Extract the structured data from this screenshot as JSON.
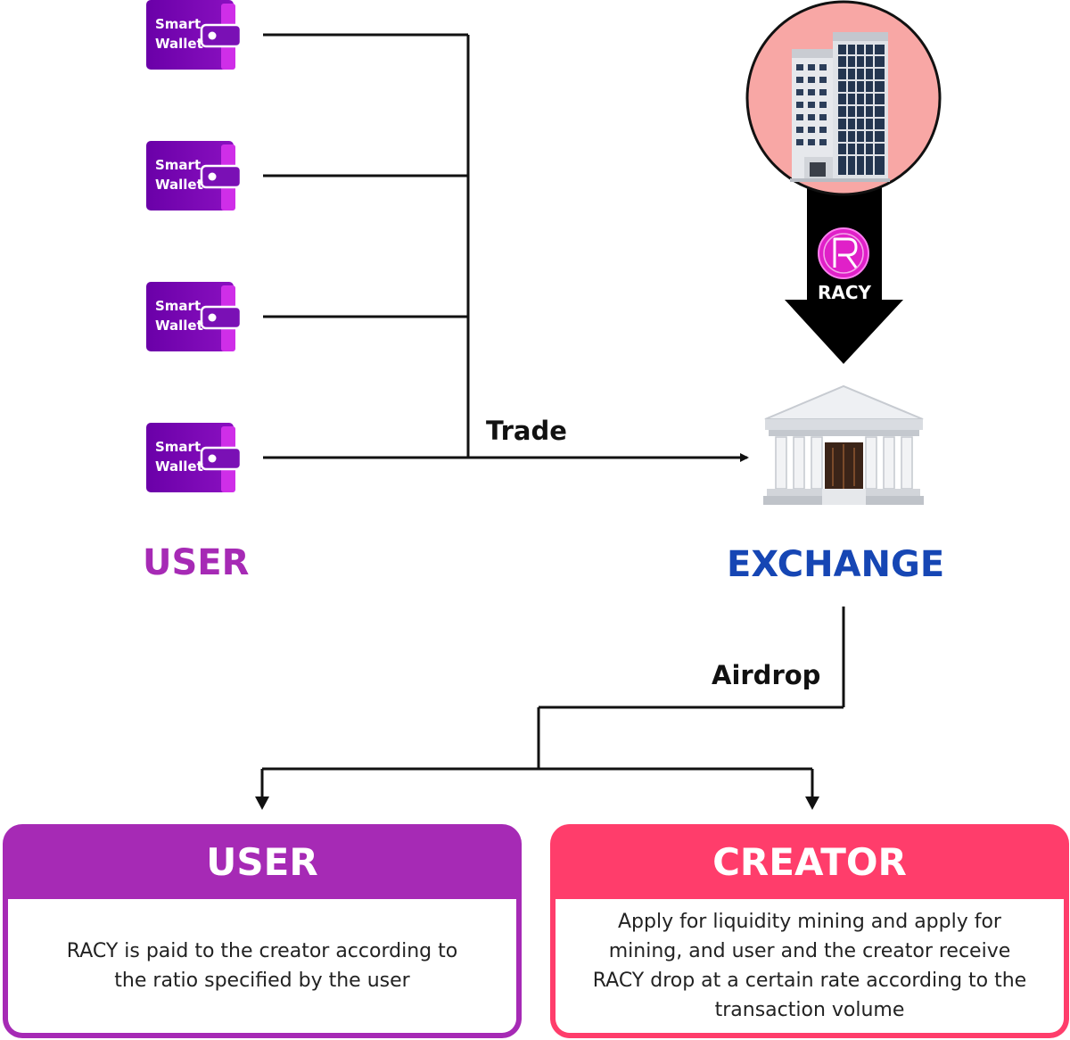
{
  "wallets": [
    {
      "line1": "Smart",
      "line2": "Wallet"
    },
    {
      "line1": "Smart",
      "line2": "Wallet"
    },
    {
      "line1": "Smart",
      "line2": "Wallet"
    },
    {
      "line1": "Smart",
      "line2": "Wallet"
    }
  ],
  "labels": {
    "trade": "Trade",
    "airdrop": "Airdrop",
    "token": "RACY",
    "user_side": "USER",
    "exchange_side": "EXCHANGE"
  },
  "cards": {
    "user": {
      "title": "USER",
      "text": "RACY is paid to the creator according to the ratio specified by the user"
    },
    "creator": {
      "title": "CREATOR",
      "text": "Apply for liquidity mining and apply for mining, and user and the creator receive RACY drop at a certain rate according to the transaction volume"
    }
  },
  "colors": {
    "user_purple": "#a62ab5",
    "exchange_blue": "#1646b4",
    "creator_pink": "#ff3d6b",
    "wallet_dark": "#6a00a8",
    "wallet_light": "#cf2ee8",
    "token_magenta": "#e020c8",
    "building_bg": "#f8a7a5"
  },
  "icons": {
    "wallet": "wallet-icon",
    "building": "office-building-icon",
    "exchange": "bank-building-icon",
    "token": "racy-token-icon"
  }
}
